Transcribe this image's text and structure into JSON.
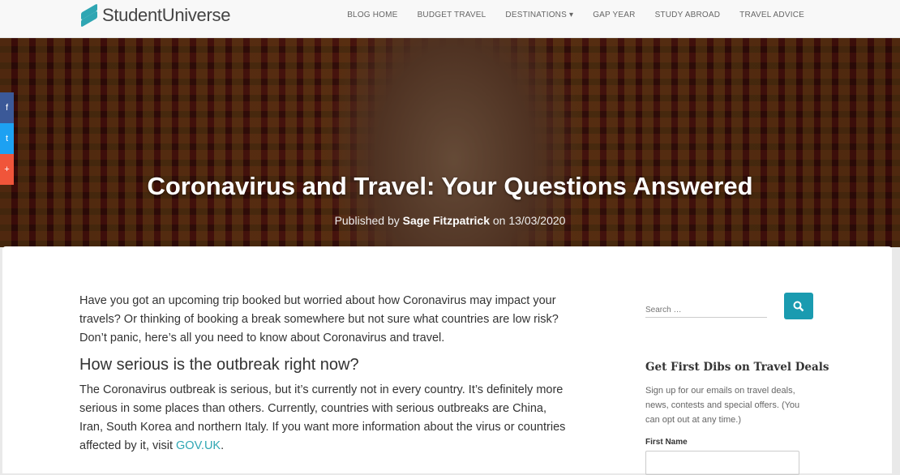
{
  "header": {
    "logo": "StudentUniverse",
    "nav": [
      "BLOG HOME",
      "BUDGET TRAVEL",
      "DESTINATIONS ▾",
      "GAP YEAR",
      "STUDY ABROAD",
      "TRAVEL ADVICE"
    ]
  },
  "hero": {
    "title": "Coronavirus and Travel: Your Questions Answered",
    "published_by": "Published by",
    "author": "Sage Fitzpatrick",
    "on": "on 13/03/2020"
  },
  "share": [
    {
      "icon": "facebook-icon",
      "glyph": "f",
      "color": "#3b5998"
    },
    {
      "icon": "twitter-icon",
      "glyph": "t",
      "color": "#1da1f2"
    },
    {
      "icon": "share-icon",
      "glyph": "+",
      "color": "#f0553a"
    }
  ],
  "article": {
    "intro": "Have you got an upcoming trip booked but worried about how Coronavirus may impact your travels? Or thinking of booking a break somewhere but not sure what countries are low risk? Don’t panic, here’s all you need to know about Coronavirus and travel.",
    "h2": "How serious is the outbreak right now?",
    "p2": "The Coronavirus outbreak is serious, but it’s currently not in every country. It’s definitely more serious in some places than others. Currently, countries with serious outbreaks are China, Iran, South Korea and northern Italy. If you want more information about the virus or countries affected by it, visit ",
    "link": "GOV.UK",
    "p2_end": "."
  },
  "sidebar": {
    "search_placeholder": "Search …",
    "deals_title": "Get First Dibs on Travel Deals",
    "deals_text": "Sign up for our emails on travel deals, news, contests and special offers. (You can opt out at any time.)",
    "first_name_label": "First Name"
  },
  "colors": {
    "accent": "#1a9bb0"
  }
}
